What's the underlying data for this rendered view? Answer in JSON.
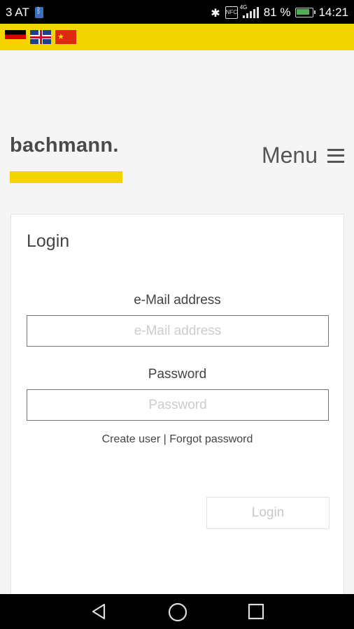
{
  "status_bar": {
    "carrier": "3 AT",
    "network": "4G",
    "battery": "81 %",
    "time": "14:21",
    "icons": [
      "bluetooth-icon",
      "nfc-icon",
      "signal-icon",
      "battery-icon"
    ]
  },
  "languages": [
    {
      "name": "German",
      "icon": "flag-de-icon"
    },
    {
      "name": "English",
      "icon": "flag-uk-icon"
    },
    {
      "name": "Chinese",
      "icon": "flag-cn-icon"
    }
  ],
  "header": {
    "logo": "bachmann.",
    "menu_label": "Menu",
    "brand_color": "#f2d600"
  },
  "login": {
    "title": "Login",
    "email_label": "e-Mail address",
    "email_placeholder": "e-Mail address",
    "password_label": "Password",
    "password_placeholder": "Password",
    "create_user": "Create user",
    "separator": " | ",
    "forgot_password": "Forgot password",
    "button": "Login"
  }
}
